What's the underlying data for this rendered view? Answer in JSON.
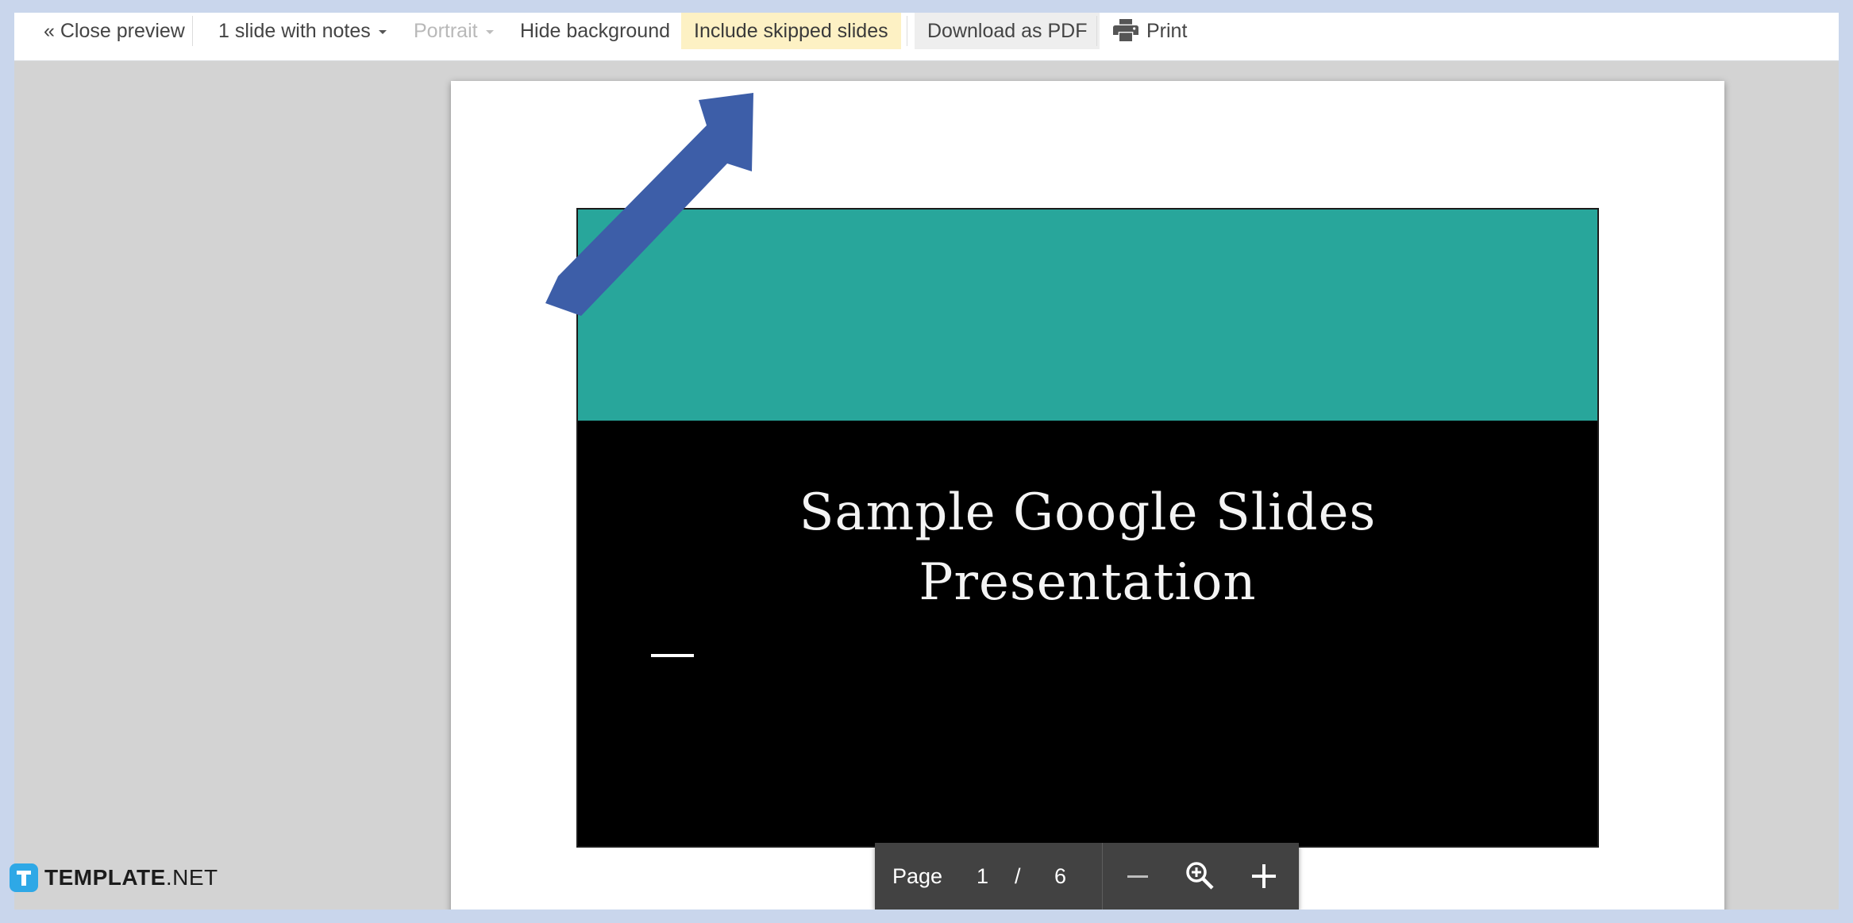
{
  "toolbar": {
    "close_preview": "« Close preview",
    "layout_option": "1 slide with notes",
    "orientation": "Portrait",
    "hide_background": "Hide background",
    "include_skipped": "Include skipped slides",
    "download_pdf": "Download as PDF",
    "print": "Print"
  },
  "slide": {
    "title_line1": "Sample Google Slides",
    "title_line2": "Presentation"
  },
  "pager": {
    "page_label": "Page",
    "current_page": "1",
    "separator": "/",
    "total_pages": "6"
  },
  "watermark": {
    "brand_bold": "TEMPLATE",
    "brand_suffix": ".NET"
  },
  "colors": {
    "slide_band": "#28a69b",
    "highlight": "#fdf1c4",
    "annotation_arrow": "#3d5ea8",
    "pager_bg": "#424242"
  },
  "icons": [
    "print-icon",
    "zoom-out-icon",
    "zoom-in-icon",
    "zoom-plus-icon",
    "caret-down-icon",
    "annotation-arrow-icon"
  ]
}
